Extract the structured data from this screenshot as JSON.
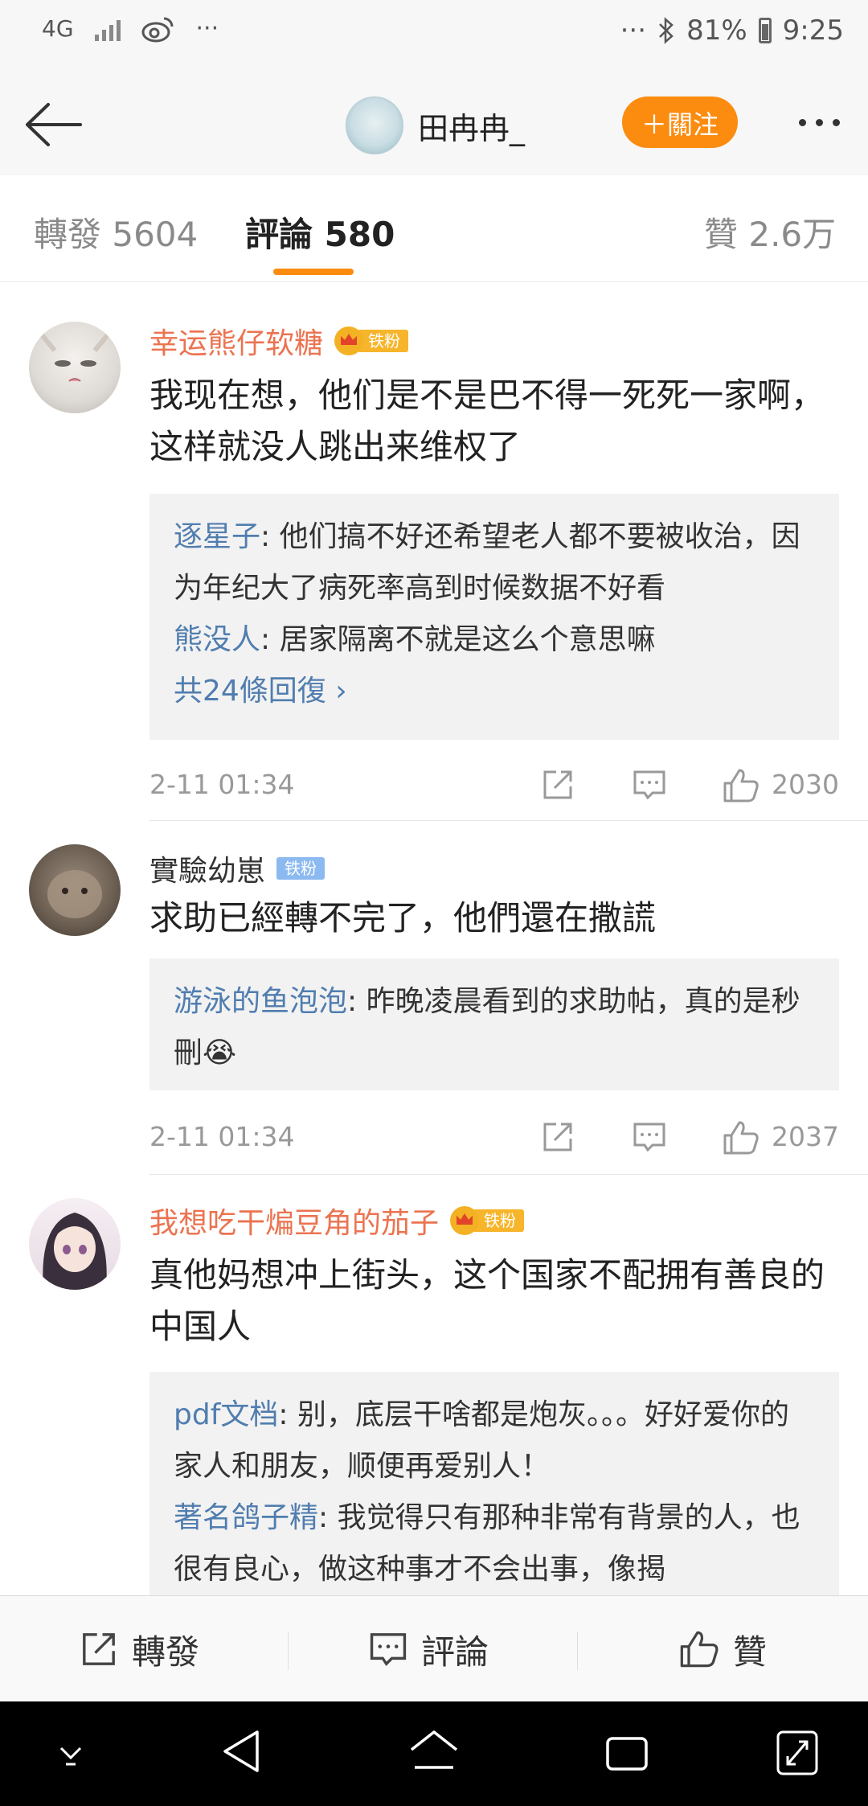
{
  "status_bar": {
    "network": "4G",
    "more_left": "···",
    "more_right": "···",
    "battery": "81%",
    "time": "9:25"
  },
  "nav": {
    "title": "田冉冉_",
    "follow_label": "＋關注"
  },
  "tabs": {
    "repost": "轉發 5604",
    "comments": "評論 580",
    "likes": "贊 2.6万"
  },
  "comments": [
    {
      "user": "幸运熊仔软糖",
      "badge": "铁粉",
      "text": "我现在想，他们是不是巴不得一死死一家啊，这样就没人跳出来维权了",
      "replies": [
        {
          "user": "逐星子",
          "text": ": 他们搞不好还希望老人都不要被收治，因为年纪大了病死率高到时候数据不好看"
        },
        {
          "user": "熊没人",
          "text": ": 居家隔离不就是这么个意思嘛"
        }
      ],
      "more": "共24條回復 ›",
      "time": "2-11 01:34",
      "likes": "2030"
    },
    {
      "user": "實驗幼崽",
      "badge": "铁粉",
      "text": "求助已經轉不完了，他們還在撒謊",
      "replies": [
        {
          "user": "游泳的鱼泡泡",
          "text": ": 昨晚凌晨看到的求助帖，真的是秒刪😭"
        }
      ],
      "time": "2-11 01:34",
      "likes": "2037"
    },
    {
      "user": "我想吃干煸豆角的茄子",
      "badge": "铁粉",
      "text": "真他妈想冲上街头，这个国家不配拥有善良的中国人",
      "replies": [
        {
          "user": "pdf文档",
          "text": ": 别，底层干啥都是炮灰。。。好好爱你的家人和朋友，顺便再爱别人！"
        },
        {
          "user": "著名鸽子精",
          "text": ": 我觉得只有那种非常有背景的人，也很有良心，做这种事才不会出事，像揭"
        }
      ]
    }
  ],
  "bottom_bar": {
    "repost": "轉發",
    "comment": "評論",
    "like": "贊"
  },
  "colors": {
    "accent": "#fb8c10",
    "username": "#eb7350",
    "reply_user": "#507daf"
  }
}
